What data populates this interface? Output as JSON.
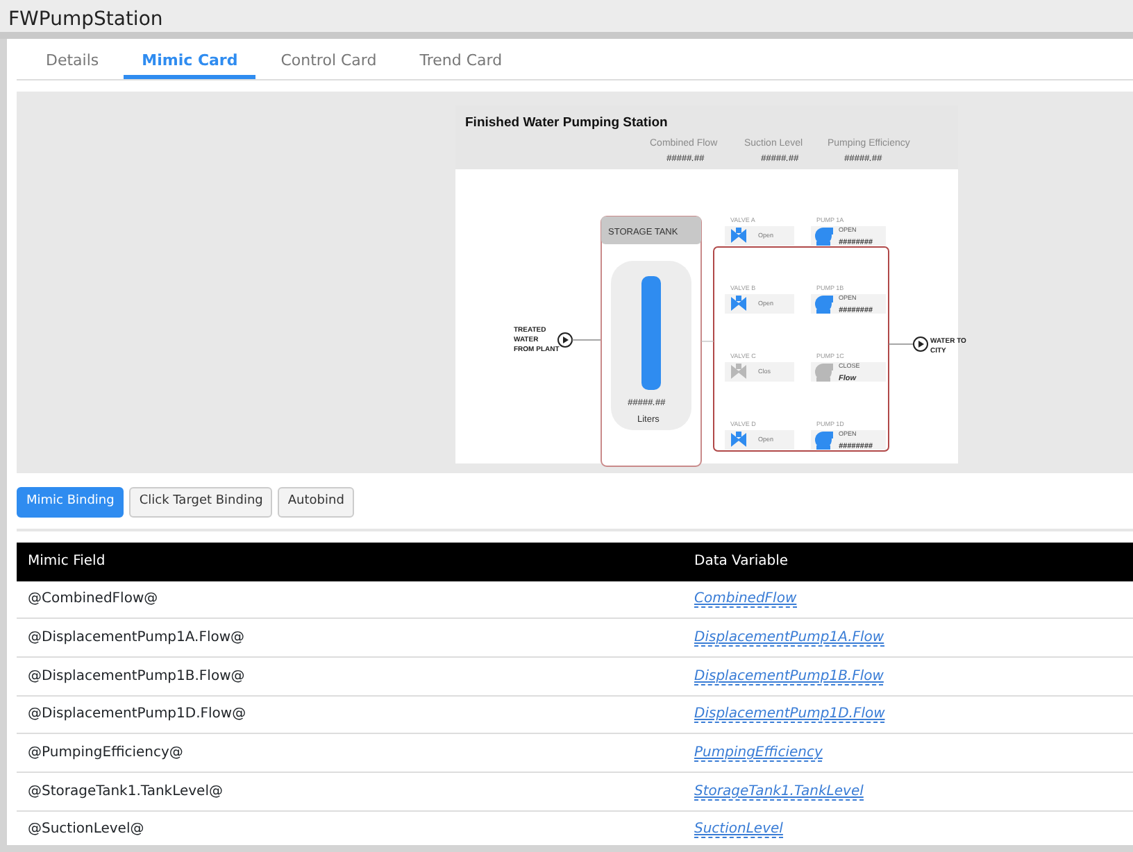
{
  "window": {
    "title": "FWPumpStation"
  },
  "tabs": [
    {
      "label": "Details",
      "selected": false
    },
    {
      "label": "Mimic Card",
      "selected": true
    },
    {
      "label": "Control Card",
      "selected": false
    },
    {
      "label": "Trend Card",
      "selected": false
    }
  ],
  "mimic": {
    "title": "Finished Water Pumping Station",
    "stats": [
      {
        "label": "Combined Flow",
        "value": "#####.##"
      },
      {
        "label": "Suction Level",
        "value": "#####.##"
      },
      {
        "label": "Pumping Efficiency",
        "value": "#####.##"
      }
    ],
    "inlet": {
      "lines": [
        "TREATED",
        "WATER",
        "FROM PLANT"
      ]
    },
    "outlet": {
      "lines": [
        "WATER TO",
        "CITY"
      ]
    },
    "tank": {
      "title": "STORAGE TANK",
      "value": "#####.##",
      "unit": "Liters"
    },
    "branches": [
      {
        "valve": "VALVE A",
        "valve_state": "Open",
        "pump": "PUMP 1A",
        "pump_state": "OPEN",
        "reading": "########",
        "active": true
      },
      {
        "valve": "VALVE B",
        "valve_state": "Open",
        "pump": "PUMP 1B",
        "pump_state": "OPEN",
        "reading": "########",
        "active": true
      },
      {
        "valve": "VALVE C",
        "valve_state": "Clos",
        "pump": "PUMP 1C",
        "pump_state": "CLOSE",
        "reading": "Flow",
        "active": false
      },
      {
        "valve": "VALVE D",
        "valve_state": "Open",
        "pump": "PUMP 1D",
        "pump_state": "OPEN",
        "reading": "########",
        "active": true
      }
    ]
  },
  "binding_tabs": [
    {
      "label": "Mimic Binding",
      "selected": true
    },
    {
      "label": "Click Target Binding",
      "selected": false
    },
    {
      "label": "Autobind",
      "selected": false
    }
  ],
  "table": {
    "columns": [
      "Mimic Field",
      "Data Variable"
    ],
    "rows": [
      [
        "@CombinedFlow@",
        "CombinedFlow"
      ],
      [
        "@DisplacementPump1A.Flow@",
        "DisplacementPump1A.Flow"
      ],
      [
        "@DisplacementPump1B.Flow@",
        "DisplacementPump1B.Flow"
      ],
      [
        "@DisplacementPump1D.Flow@",
        "DisplacementPump1D.Flow"
      ],
      [
        "@PumpingEfficiency@",
        "PumpingEfficiency"
      ],
      [
        "@StorageTank1.TankLevel@",
        "StorageTank1.TankLevel"
      ],
      [
        "@SuctionLevel@",
        "SuctionLevel"
      ]
    ]
  }
}
